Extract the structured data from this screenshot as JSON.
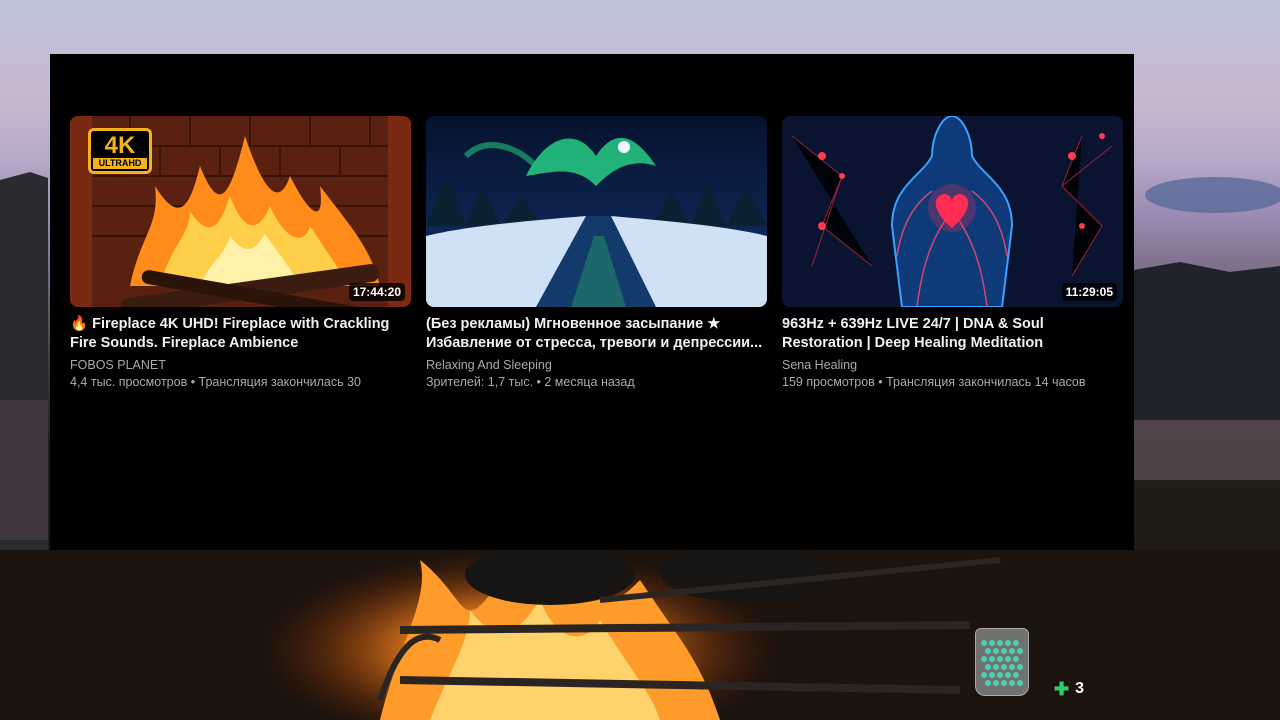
{
  "videos": [
    {
      "title": "🔥 Fireplace 4K UHD! Fireplace with Crackling Fire Sounds. Fireplace Ambience",
      "channel": "FOBOS PLANET",
      "meta": "4,4 тыс. просмотров • Трансляция закончилась 30",
      "duration": "17:44:20",
      "badge_big": "4K",
      "badge_small": "ULTRAHD"
    },
    {
      "title": "(Без рекламы) Мгновенное засыпание ★ Избавление от стресса, тревоги и депрессии...",
      "channel": "Relaxing And Sleeping",
      "meta": "Зрителей: 1,7 тыс. • 2 месяца назад",
      "duration": ""
    },
    {
      "title": "963Hz + 639Hz LIVE 24/7 | DNA & Soul Restoration | Deep Healing Meditation",
      "channel": "Sena Healing",
      "meta": "159 просмотров • Трансляция закончилась 14 часов",
      "duration": "11:29:05"
    }
  ],
  "counter": {
    "value": "3",
    "icon": "puzzle-icon"
  },
  "colors": {
    "overlay": "#000000",
    "meta": "#aaaaaa",
    "badge": "#f6b21b",
    "counter_icon": "#2ecc71"
  }
}
